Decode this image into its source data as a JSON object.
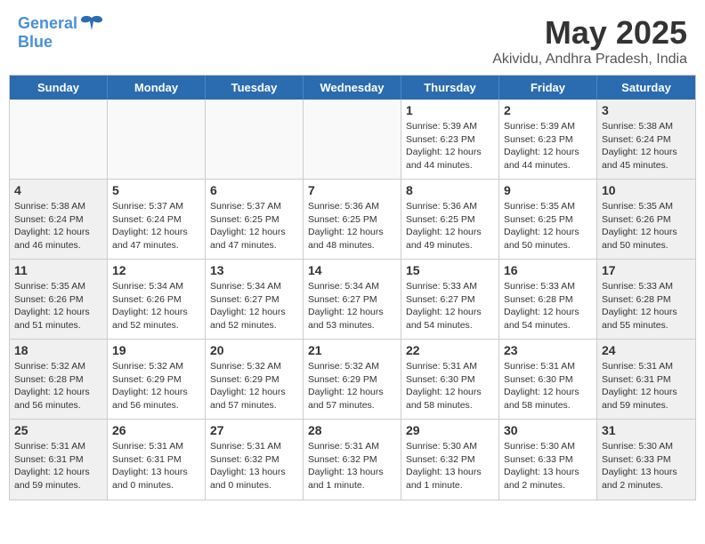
{
  "header": {
    "logo_line1": "General",
    "logo_line2": "Blue",
    "month_title": "May 2025",
    "location": "Akividu, Andhra Pradesh, India"
  },
  "day_headers": [
    "Sunday",
    "Monday",
    "Tuesday",
    "Wednesday",
    "Thursday",
    "Friday",
    "Saturday"
  ],
  "weeks": [
    [
      {
        "day": "",
        "empty": true
      },
      {
        "day": "",
        "empty": true
      },
      {
        "day": "",
        "empty": true
      },
      {
        "day": "",
        "empty": true
      },
      {
        "day": "1",
        "lines": [
          "Sunrise: 5:39 AM",
          "Sunset: 6:23 PM",
          "Daylight: 12 hours",
          "and 44 minutes."
        ]
      },
      {
        "day": "2",
        "lines": [
          "Sunrise: 5:39 AM",
          "Sunset: 6:23 PM",
          "Daylight: 12 hours",
          "and 44 minutes."
        ]
      },
      {
        "day": "3",
        "lines": [
          "Sunrise: 5:38 AM",
          "Sunset: 6:24 PM",
          "Daylight: 12 hours",
          "and 45 minutes."
        ]
      }
    ],
    [
      {
        "day": "4",
        "lines": [
          "Sunrise: 5:38 AM",
          "Sunset: 6:24 PM",
          "Daylight: 12 hours",
          "and 46 minutes."
        ]
      },
      {
        "day": "5",
        "lines": [
          "Sunrise: 5:37 AM",
          "Sunset: 6:24 PM",
          "Daylight: 12 hours",
          "and 47 minutes."
        ]
      },
      {
        "day": "6",
        "lines": [
          "Sunrise: 5:37 AM",
          "Sunset: 6:25 PM",
          "Daylight: 12 hours",
          "and 47 minutes."
        ]
      },
      {
        "day": "7",
        "lines": [
          "Sunrise: 5:36 AM",
          "Sunset: 6:25 PM",
          "Daylight: 12 hours",
          "and 48 minutes."
        ]
      },
      {
        "day": "8",
        "lines": [
          "Sunrise: 5:36 AM",
          "Sunset: 6:25 PM",
          "Daylight: 12 hours",
          "and 49 minutes."
        ]
      },
      {
        "day": "9",
        "lines": [
          "Sunrise: 5:35 AM",
          "Sunset: 6:25 PM",
          "Daylight: 12 hours",
          "and 50 minutes."
        ]
      },
      {
        "day": "10",
        "lines": [
          "Sunrise: 5:35 AM",
          "Sunset: 6:26 PM",
          "Daylight: 12 hours",
          "and 50 minutes."
        ]
      }
    ],
    [
      {
        "day": "11",
        "lines": [
          "Sunrise: 5:35 AM",
          "Sunset: 6:26 PM",
          "Daylight: 12 hours",
          "and 51 minutes."
        ]
      },
      {
        "day": "12",
        "lines": [
          "Sunrise: 5:34 AM",
          "Sunset: 6:26 PM",
          "Daylight: 12 hours",
          "and 52 minutes."
        ]
      },
      {
        "day": "13",
        "lines": [
          "Sunrise: 5:34 AM",
          "Sunset: 6:27 PM",
          "Daylight: 12 hours",
          "and 52 minutes."
        ]
      },
      {
        "day": "14",
        "lines": [
          "Sunrise: 5:34 AM",
          "Sunset: 6:27 PM",
          "Daylight: 12 hours",
          "and 53 minutes."
        ]
      },
      {
        "day": "15",
        "lines": [
          "Sunrise: 5:33 AM",
          "Sunset: 6:27 PM",
          "Daylight: 12 hours",
          "and 54 minutes."
        ]
      },
      {
        "day": "16",
        "lines": [
          "Sunrise: 5:33 AM",
          "Sunset: 6:28 PM",
          "Daylight: 12 hours",
          "and 54 minutes."
        ]
      },
      {
        "day": "17",
        "lines": [
          "Sunrise: 5:33 AM",
          "Sunset: 6:28 PM",
          "Daylight: 12 hours",
          "and 55 minutes."
        ]
      }
    ],
    [
      {
        "day": "18",
        "lines": [
          "Sunrise: 5:32 AM",
          "Sunset: 6:28 PM",
          "Daylight: 12 hours",
          "and 56 minutes."
        ]
      },
      {
        "day": "19",
        "lines": [
          "Sunrise: 5:32 AM",
          "Sunset: 6:29 PM",
          "Daylight: 12 hours",
          "and 56 minutes."
        ]
      },
      {
        "day": "20",
        "lines": [
          "Sunrise: 5:32 AM",
          "Sunset: 6:29 PM",
          "Daylight: 12 hours",
          "and 57 minutes."
        ]
      },
      {
        "day": "21",
        "lines": [
          "Sunrise: 5:32 AM",
          "Sunset: 6:29 PM",
          "Daylight: 12 hours",
          "and 57 minutes."
        ]
      },
      {
        "day": "22",
        "lines": [
          "Sunrise: 5:31 AM",
          "Sunset: 6:30 PM",
          "Daylight: 12 hours",
          "and 58 minutes."
        ]
      },
      {
        "day": "23",
        "lines": [
          "Sunrise: 5:31 AM",
          "Sunset: 6:30 PM",
          "Daylight: 12 hours",
          "and 58 minutes."
        ]
      },
      {
        "day": "24",
        "lines": [
          "Sunrise: 5:31 AM",
          "Sunset: 6:31 PM",
          "Daylight: 12 hours",
          "and 59 minutes."
        ]
      }
    ],
    [
      {
        "day": "25",
        "lines": [
          "Sunrise: 5:31 AM",
          "Sunset: 6:31 PM",
          "Daylight: 12 hours",
          "and 59 minutes."
        ]
      },
      {
        "day": "26",
        "lines": [
          "Sunrise: 5:31 AM",
          "Sunset: 6:31 PM",
          "Daylight: 13 hours",
          "and 0 minutes."
        ]
      },
      {
        "day": "27",
        "lines": [
          "Sunrise: 5:31 AM",
          "Sunset: 6:32 PM",
          "Daylight: 13 hours",
          "and 0 minutes."
        ]
      },
      {
        "day": "28",
        "lines": [
          "Sunrise: 5:31 AM",
          "Sunset: 6:32 PM",
          "Daylight: 13 hours",
          "and 1 minute."
        ]
      },
      {
        "day": "29",
        "lines": [
          "Sunrise: 5:30 AM",
          "Sunset: 6:32 PM",
          "Daylight: 13 hours",
          "and 1 minute."
        ]
      },
      {
        "day": "30",
        "lines": [
          "Sunrise: 5:30 AM",
          "Sunset: 6:33 PM",
          "Daylight: 13 hours",
          "and 2 minutes."
        ]
      },
      {
        "day": "31",
        "lines": [
          "Sunrise: 5:30 AM",
          "Sunset: 6:33 PM",
          "Daylight: 13 hours",
          "and 2 minutes."
        ]
      }
    ]
  ]
}
